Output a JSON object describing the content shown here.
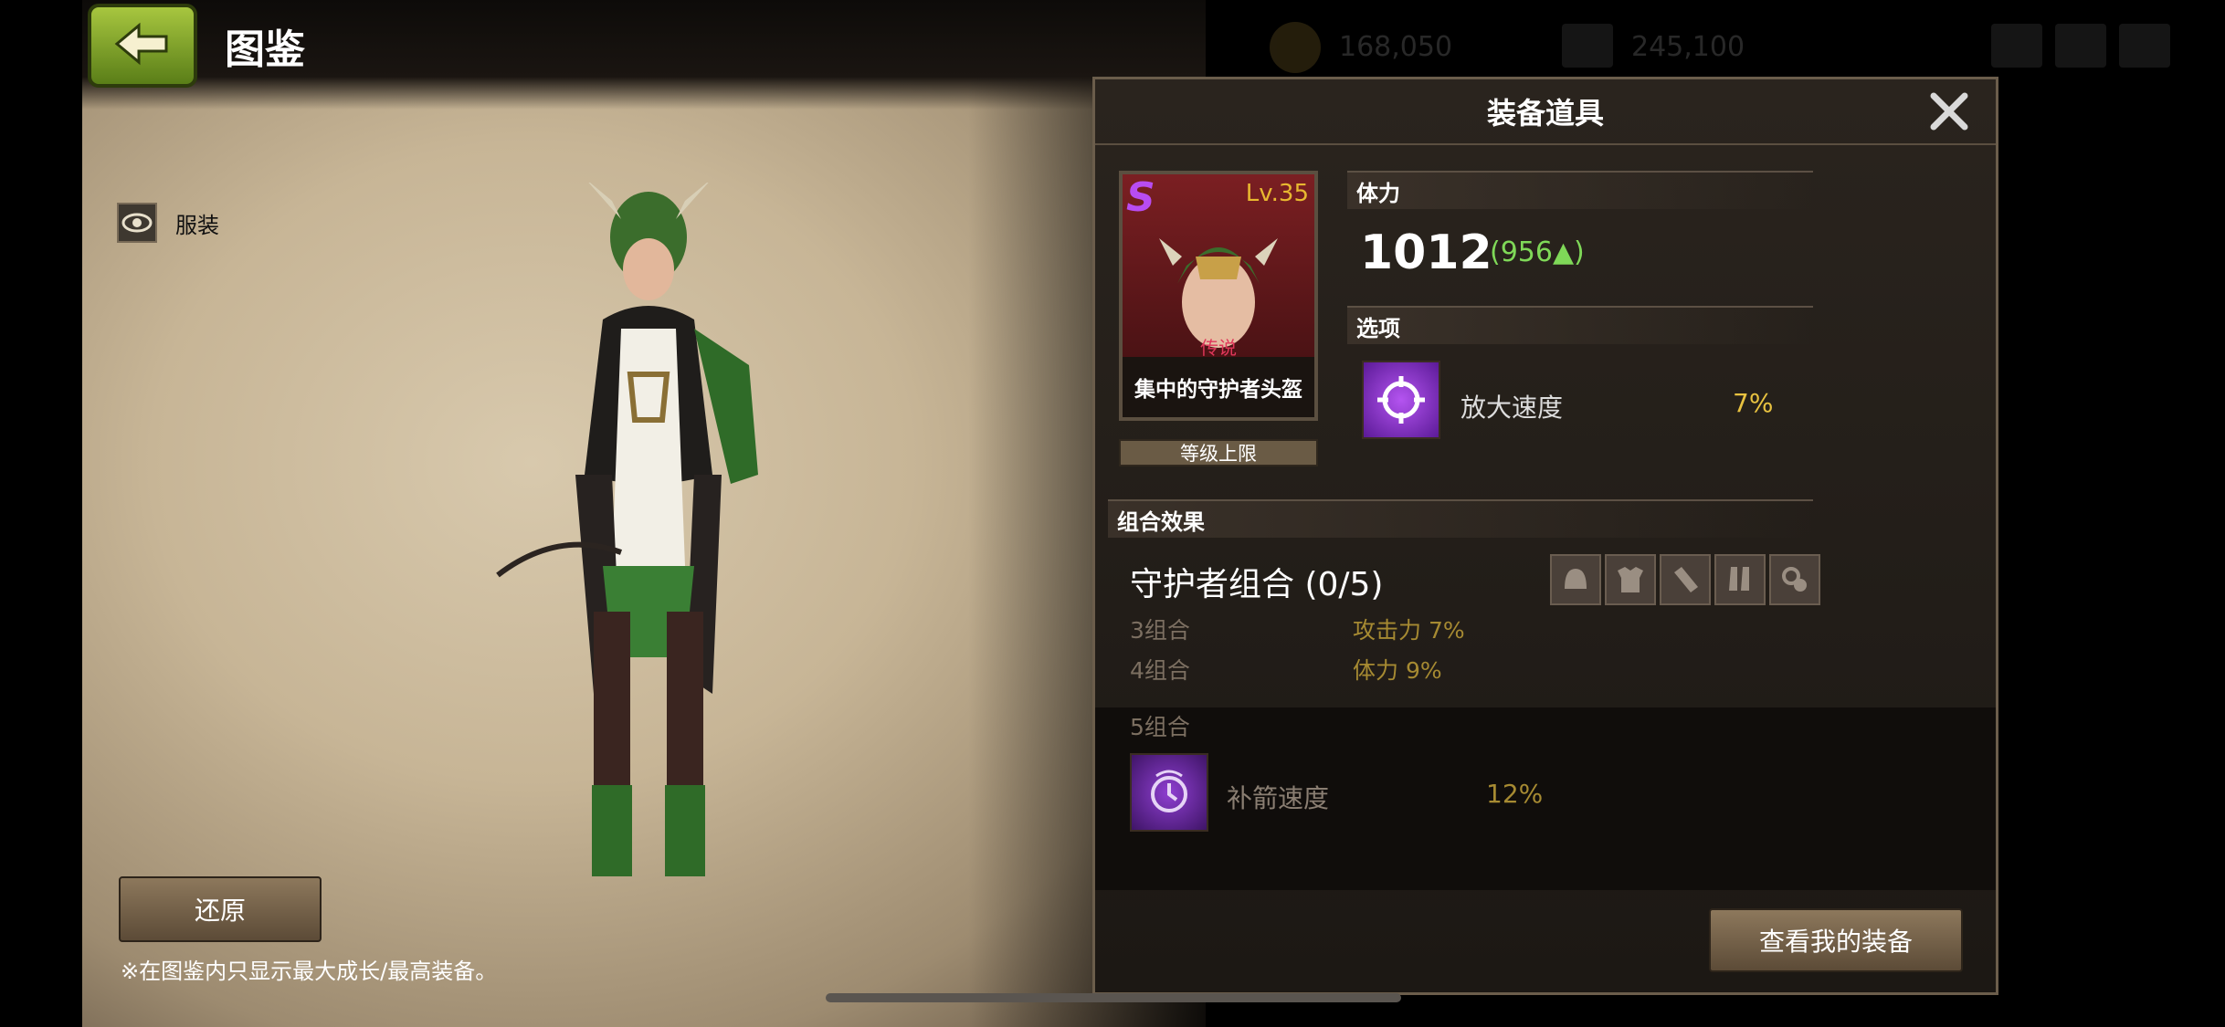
{
  "header": {
    "title": "图鉴",
    "back_icon": "back-arrow-icon"
  },
  "costume": {
    "label": "服装",
    "icon": "eye-icon"
  },
  "restore_button": "还原",
  "footnote": "※在图鉴内只显示最大成长/最高装备。",
  "currency": {
    "gold": "168,050",
    "other": "245,100"
  },
  "panel": {
    "title": "装备道具",
    "close_icon": "close-icon",
    "item": {
      "rank": "S",
      "level": "Lv.35",
      "grade": "传说",
      "name": "集中的守护者头盔",
      "level_cap": "等级上限"
    },
    "stamina": {
      "header": "体力",
      "value": "1012",
      "delta": "(956▲)"
    },
    "options": {
      "header": "选项",
      "name": "放大速度",
      "value": "7%"
    },
    "set": {
      "header": "组合效果",
      "name": "守护者组合 (0/5)",
      "slots": [
        "helmet-icon",
        "armor-icon",
        "bracer-icon",
        "boots-icon",
        "accessory-icon"
      ],
      "rows": [
        {
          "label": "3组合",
          "value": "攻击力 7%"
        },
        {
          "label": "4组合",
          "value": "体力 9%"
        }
      ],
      "five_label": "5组合",
      "five_effect": "补箭速度",
      "five_value": "12%"
    },
    "my_equipment_button": "查看我的装备"
  },
  "colors": {
    "accent_green": "#7fd858",
    "gold_text": "#e8c240",
    "legend_red": "#e0375a",
    "rank_purple": "#b84cf2"
  }
}
